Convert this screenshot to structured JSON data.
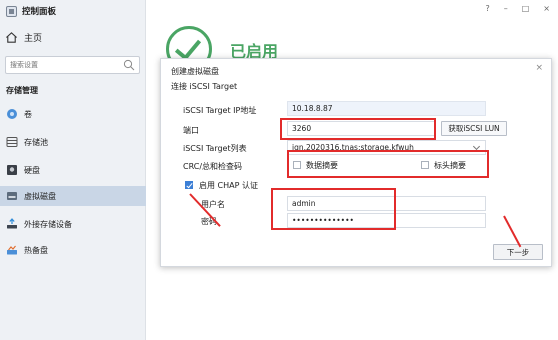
{
  "sidebar": {
    "title": "控制面板",
    "home": "主页",
    "search_placeholder": "搜索设置",
    "section": "存储管理",
    "items": [
      {
        "label": "卷"
      },
      {
        "label": "存储池"
      },
      {
        "label": "硬盘"
      },
      {
        "label": "虚拟磁盘"
      },
      {
        "label": "外接存储设备"
      },
      {
        "label": "热备盘"
      }
    ]
  },
  "window_controls": {
    "help": "?",
    "minimize": "–",
    "maximize": "□",
    "close": "×"
  },
  "status": {
    "text": "已启用"
  },
  "dialog": {
    "title": "创建虚拟磁盘",
    "close": "×",
    "subtitle": "连接 iSCSI Target",
    "ip_label": "iSCSI Target IP地址",
    "ip_value": "10.18.8.87",
    "port_label": "端口",
    "port_value": "3260",
    "get_lun_button": "获取iSCSI LUN",
    "target_list_label": "iSCSI Target列表",
    "target_list_value": "iqn.2020316.tnas:storage.kfwuh",
    "crc_label": "CRC/总和检查码",
    "data_digest": "数据摘要",
    "header_digest": "标头摘要",
    "chap_label": "启用 CHAP 认证",
    "username_label": "用户名",
    "username_value": "admin",
    "password_label": "密码",
    "password_value": "••••••••••••••",
    "next_button": "下一步"
  },
  "colors": {
    "accent": "#3c7fd6",
    "success": "#4aa564",
    "annotation": "#e22b2b"
  }
}
